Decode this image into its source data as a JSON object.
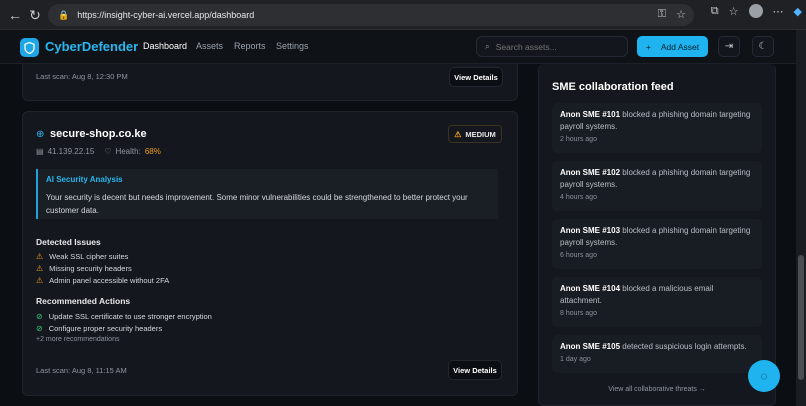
{
  "browser": {
    "url": "https://insight-cyber-ai.vercel.app/dashboard"
  },
  "header": {
    "brand": "CyberDefender",
    "nav": [
      "Dashboard",
      "Assets",
      "Reports",
      "Settings"
    ],
    "search_placeholder": "Search assets...",
    "add_label": "Add Asset"
  },
  "prev_card": {
    "last_scan": "Last scan: Aug 8, 12:30 PM",
    "view_label": "View Details"
  },
  "asset_card": {
    "domain": "secure-shop.co.ke",
    "risk_badge": "MEDIUM",
    "ip": "41.139.22.15",
    "health_label": "Health:",
    "health_value": "68%",
    "ai_title": "AI Security Analysis",
    "ai_text": "Your security is decent but needs improvement. Some minor vulnerabilities could be strengthened to better protect your customer data.",
    "issues_title": "Detected Issues",
    "issues": [
      "Weak SSL cipher suites",
      "Missing security headers",
      "Admin panel accessible without 2FA"
    ],
    "actions_title": "Recommended Actions",
    "actions": [
      "Update SSL certificate to use stronger encryption",
      "Configure proper security headers"
    ],
    "more": "+2 more recommendations",
    "last_scan": "Last scan: Aug 8, 11:15 AM",
    "view_label": "View Details"
  },
  "feed": {
    "title": "SME collaboration feed",
    "items": [
      {
        "who": "Anon SME #101",
        "text": " blocked a phishing domain targeting payroll systems.",
        "time": "2 hours ago"
      },
      {
        "who": "Anon SME #102",
        "text": " blocked a phishing domain targeting payroll systems.",
        "time": "4 hours ago"
      },
      {
        "who": "Anon SME #103",
        "text": " blocked a phishing domain targeting payroll systems.",
        "time": "6 hours ago"
      },
      {
        "who": "Anon SME #104",
        "text": " blocked a malicious email attachment.",
        "time": "8 hours ago"
      },
      {
        "who": "Anon SME #105",
        "text": " detected suspicious login attempts.",
        "time": "1 day ago"
      }
    ],
    "view_all": "View all collaborative threats →"
  },
  "colors": {
    "accent": "#1fb4ef",
    "warning": "#f0a020",
    "success": "#33c77a",
    "background": "#0b0e13"
  },
  "icons": [
    "back-icon",
    "refresh-icon",
    "lock-icon",
    "shield-logo-icon",
    "search-icon",
    "plus-icon",
    "logout-icon",
    "moon-icon",
    "globe-icon",
    "server-icon",
    "heart-icon",
    "warning-icon",
    "check-circle-icon",
    "chat-icon"
  ]
}
